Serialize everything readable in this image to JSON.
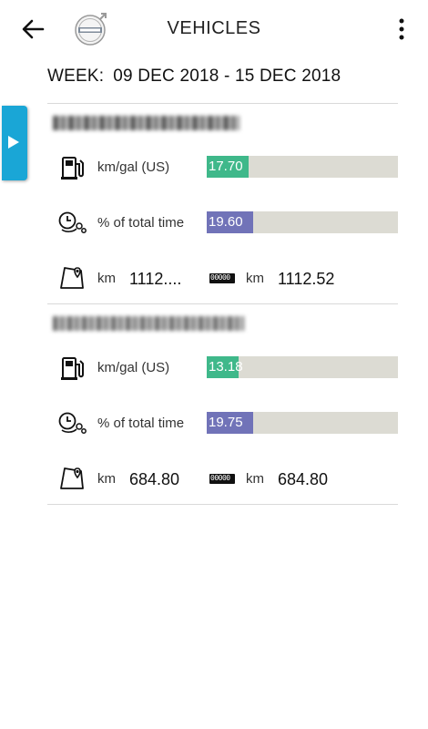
{
  "header": {
    "title": "VEHICLES"
  },
  "week": {
    "label": "WEEK:",
    "range": "09 DEC 2018 - 15 DEC 2018"
  },
  "colors": {
    "fuel_bar": "#3fb88a",
    "time_bar": "#7173b8",
    "bar_track": "#dcdbd3",
    "side_tab": "#1aa6d6"
  },
  "vehicles": [
    {
      "fuel_label": "km/gal (US)",
      "fuel_value": "17.70",
      "fuel_fraction": 0.22,
      "time_label": "% of total time",
      "time_value": "19.60",
      "time_fraction": 0.196,
      "distance_unit": "km",
      "distance_value": "1112....",
      "odometer_text": "00000",
      "odometer_unit": "km",
      "odometer_value": "1112.52"
    },
    {
      "fuel_label": "km/gal (US)",
      "fuel_value": "13.18",
      "fuel_fraction": 0.165,
      "time_label": "% of total time",
      "time_value": "19.75",
      "time_fraction": 0.1975,
      "distance_unit": "km",
      "distance_value": "684.80",
      "odometer_text": "00000",
      "odometer_unit": "km",
      "odometer_value": "684.80"
    }
  ]
}
